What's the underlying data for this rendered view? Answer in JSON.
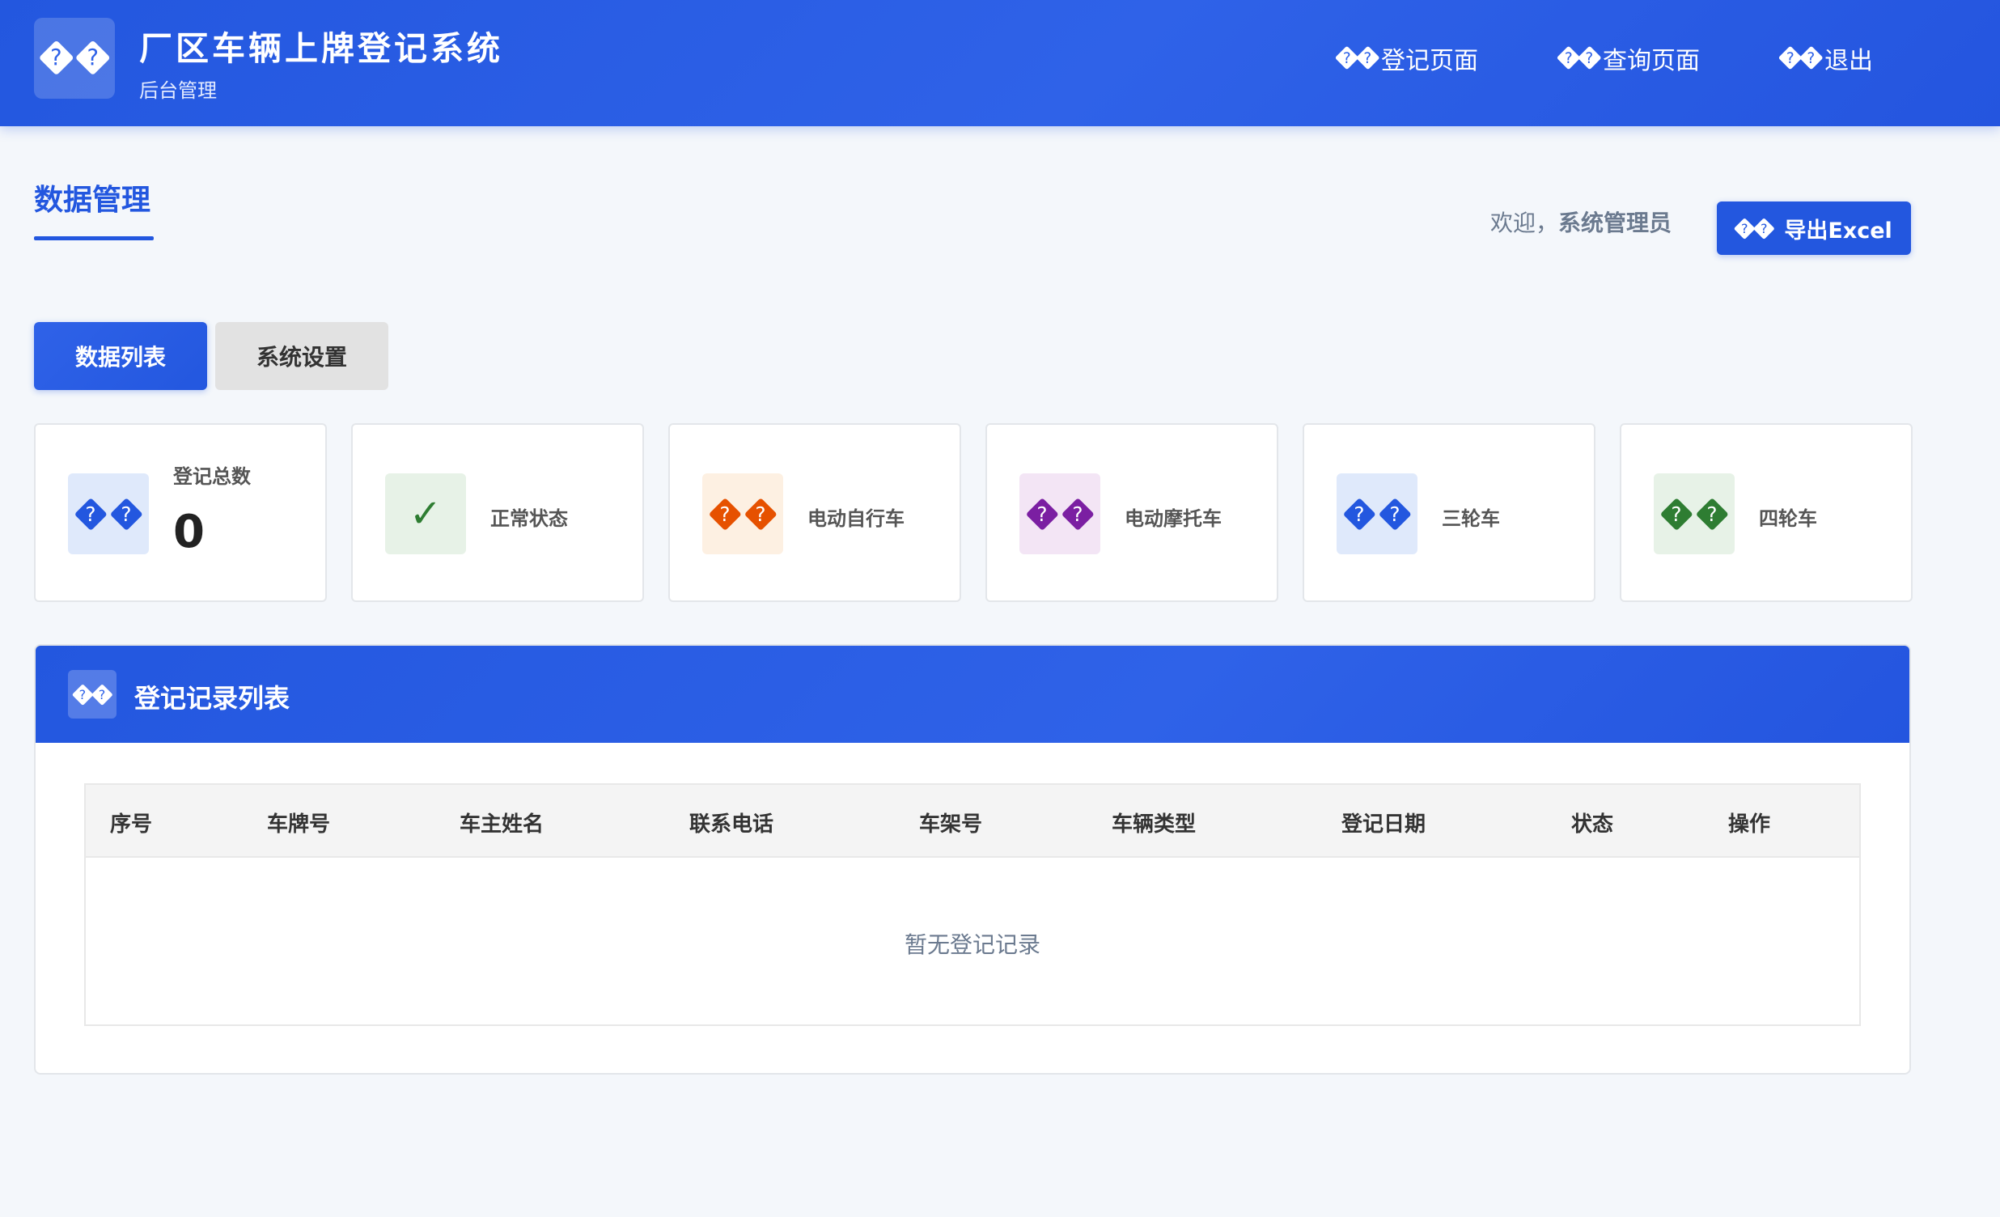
{
  "header": {
    "title": "厂区车辆上牌登记系统",
    "subtitle": "后台管理",
    "logo_icon": "replacement-char-glyphs",
    "nav": [
      {
        "label": "登记页面",
        "icon": "replacement-char-glyphs"
      },
      {
        "label": "查询页面",
        "icon": "replacement-char-glyphs"
      },
      {
        "label": "退出",
        "icon": "replacement-char-glyphs"
      }
    ]
  },
  "page": {
    "title": "数据管理",
    "welcome_prefix": "欢迎，",
    "welcome_user": "系统管理员",
    "export_label": "导出Excel"
  },
  "tabs": [
    {
      "label": "数据列表",
      "active": true
    },
    {
      "label": "系统设置",
      "active": false
    }
  ],
  "stats": [
    {
      "label": "登记总数",
      "value": "0",
      "icon": "replacement-char-glyphs",
      "color": "#2357df",
      "bg": "#dfe9fb"
    },
    {
      "label": "正常状态",
      "icon": "check-icon",
      "color": "#2e7d32",
      "bg": "#e7f2e7"
    },
    {
      "label": "电动自行车",
      "icon": "replacement-char-glyphs",
      "color": "#e65100",
      "bg": "#fdf0e2"
    },
    {
      "label": "电动摩托车",
      "icon": "replacement-char-glyphs",
      "color": "#7b1fa2",
      "bg": "#f3e5f5"
    },
    {
      "label": "三轮车",
      "icon": "replacement-char-glyphs",
      "color": "#2357df",
      "bg": "#dfe9fb"
    },
    {
      "label": "四轮车",
      "icon": "replacement-char-glyphs",
      "color": "#2e7d32",
      "bg": "#e7f2e7"
    }
  ],
  "records": {
    "title": "登记记录列表",
    "columns": [
      "序号",
      "车牌号",
      "车主姓名",
      "联系电话",
      "车架号",
      "车辆类型",
      "登记日期",
      "状态",
      "操作"
    ],
    "empty_text": "暂无登记记录"
  },
  "colors": {
    "primary": "#2357df",
    "background": "#f4f7fb"
  }
}
